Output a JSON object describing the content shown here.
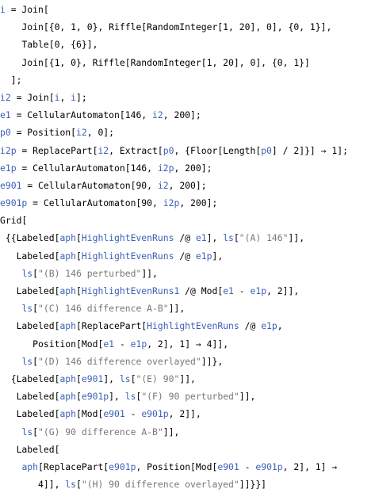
{
  "notebook": {
    "input_cell": [
      [
        [
          "u",
          "i"
        ],
        [
          "k",
          " = Join["
        ]
      ],
      [
        [
          "k",
          "    Join[{0, 1, 0}, Riffle[RandomInteger[1, 20], 0], {0, 1}],"
        ]
      ],
      [
        [
          "k",
          "    Table[0, {6}],"
        ]
      ],
      [
        [
          "k",
          "    Join[{1, 0}, Riffle[RandomInteger[1, 20], 0], {0, 1}]"
        ]
      ],
      [
        [
          "k",
          "  ];"
        ]
      ],
      [
        [
          "u",
          "i2"
        ],
        [
          "k",
          " = Join["
        ],
        [
          "u",
          "i"
        ],
        [
          "k",
          ", "
        ],
        [
          "u",
          "i"
        ],
        [
          "k",
          "];"
        ]
      ],
      [
        [
          "u",
          "e1"
        ],
        [
          "k",
          " = CellularAutomaton[146, "
        ],
        [
          "u",
          "i2"
        ],
        [
          "k",
          ", 200];"
        ]
      ],
      [
        [
          "u",
          "p0"
        ],
        [
          "k",
          " = Position["
        ],
        [
          "u",
          "i2"
        ],
        [
          "k",
          ", 0];"
        ]
      ],
      [
        [
          "u",
          "i2p"
        ],
        [
          "k",
          " = ReplacePart["
        ],
        [
          "u",
          "i2"
        ],
        [
          "k",
          ", Extract["
        ],
        [
          "u",
          "p0"
        ],
        [
          "k",
          ", {Floor[Length["
        ],
        [
          "u",
          "p0"
        ],
        [
          "k",
          "] / 2]}] → 1];"
        ]
      ],
      [
        [
          "u",
          "e1p"
        ],
        [
          "k",
          " = CellularAutomaton[146, "
        ],
        [
          "u",
          "i2p"
        ],
        [
          "k",
          ", 200];"
        ]
      ],
      [
        [
          "u",
          "e901"
        ],
        [
          "k",
          " = CellularAutomaton[90, "
        ],
        [
          "u",
          "i2"
        ],
        [
          "k",
          ", 200];"
        ]
      ],
      [
        [
          "u",
          "e901p"
        ],
        [
          "k",
          " = CellularAutomaton[90, "
        ],
        [
          "u",
          "i2p"
        ],
        [
          "k",
          ", 200];"
        ]
      ],
      [
        [
          "k",
          "Grid["
        ]
      ],
      [
        [
          "k",
          " {{Labeled["
        ],
        [
          "u",
          "aph"
        ],
        [
          "k",
          "["
        ],
        [
          "u",
          "HighlightEvenRuns"
        ],
        [
          "k",
          " /@ "
        ],
        [
          "u",
          "e1"
        ],
        [
          "k",
          "], "
        ],
        [
          "u",
          "ls"
        ],
        [
          "k",
          "["
        ],
        [
          "s",
          "\"(A) 146\""
        ],
        [
          "k",
          "]],"
        ]
      ],
      [
        [
          "k",
          "   Labeled["
        ],
        [
          "u",
          "aph"
        ],
        [
          "k",
          "["
        ],
        [
          "u",
          "HighlightEvenRuns"
        ],
        [
          "k",
          " /@ "
        ],
        [
          "u",
          "e1p"
        ],
        [
          "k",
          "],"
        ]
      ],
      [
        [
          "k",
          "    "
        ],
        [
          "u",
          "ls"
        ],
        [
          "k",
          "["
        ],
        [
          "s",
          "\"(B) 146 perturbed\""
        ],
        [
          "k",
          "]],"
        ]
      ],
      [
        [
          "k",
          "   Labeled["
        ],
        [
          "u",
          "aph"
        ],
        [
          "k",
          "["
        ],
        [
          "u",
          "HighlightEvenRuns1"
        ],
        [
          "k",
          " /@ Mod["
        ],
        [
          "u",
          "e1"
        ],
        [
          "k",
          " - "
        ],
        [
          "u",
          "e1p"
        ],
        [
          "k",
          ", 2]],"
        ]
      ],
      [
        [
          "k",
          "    "
        ],
        [
          "u",
          "ls"
        ],
        [
          "k",
          "["
        ],
        [
          "s",
          "\"(C) 146 difference A-B\""
        ],
        [
          "k",
          "]],"
        ]
      ],
      [
        [
          "k",
          "   Labeled["
        ],
        [
          "u",
          "aph"
        ],
        [
          "k",
          "[ReplacePart["
        ],
        [
          "u",
          "HighlightEvenRuns"
        ],
        [
          "k",
          " /@ "
        ],
        [
          "u",
          "e1p"
        ],
        [
          "k",
          ","
        ]
      ],
      [
        [
          "k",
          "      Position[Mod["
        ],
        [
          "u",
          "e1"
        ],
        [
          "k",
          " - "
        ],
        [
          "u",
          "e1p"
        ],
        [
          "k",
          ", 2], 1] → 4]], "
        ]
      ],
      [
        [
          "k",
          "    "
        ],
        [
          "u",
          "ls"
        ],
        [
          "k",
          "["
        ],
        [
          "s",
          "\"(D) 146 difference overlayed\""
        ],
        [
          "k",
          "]]},"
        ]
      ],
      [
        [
          "k",
          "  {Labeled["
        ],
        [
          "u",
          "aph"
        ],
        [
          "k",
          "["
        ],
        [
          "u",
          "e901"
        ],
        [
          "k",
          "], "
        ],
        [
          "u",
          "ls"
        ],
        [
          "k",
          "["
        ],
        [
          "s",
          "\"(E) 90\""
        ],
        [
          "k",
          "]],"
        ]
      ],
      [
        [
          "k",
          "   Labeled["
        ],
        [
          "u",
          "aph"
        ],
        [
          "k",
          "["
        ],
        [
          "u",
          "e901p"
        ],
        [
          "k",
          "], "
        ],
        [
          "u",
          "ls"
        ],
        [
          "k",
          "["
        ],
        [
          "s",
          "\"(F) 90 perturbed\""
        ],
        [
          "k",
          "]],"
        ]
      ],
      [
        [
          "k",
          "   Labeled["
        ],
        [
          "u",
          "aph"
        ],
        [
          "k",
          "[Mod["
        ],
        [
          "u",
          "e901"
        ],
        [
          "k",
          " - "
        ],
        [
          "u",
          "e901p"
        ],
        [
          "k",
          ", 2]],"
        ]
      ],
      [
        [
          "k",
          "    "
        ],
        [
          "u",
          "ls"
        ],
        [
          "k",
          "["
        ],
        [
          "s",
          "\"(G) 90 difference A-B\""
        ],
        [
          "k",
          "]],"
        ]
      ],
      [
        [
          "k",
          "   Labeled["
        ]
      ],
      [
        [
          "k",
          "    "
        ],
        [
          "u",
          "aph"
        ],
        [
          "k",
          "[ReplacePart["
        ],
        [
          "u",
          "e901p"
        ],
        [
          "k",
          ", Position[Mod["
        ],
        [
          "u",
          "e901"
        ],
        [
          "k",
          " - "
        ],
        [
          "u",
          "e901p"
        ],
        [
          "k",
          ", 2], 1] →"
        ]
      ],
      [
        [
          "k",
          "       4]], "
        ],
        [
          "u",
          "ls"
        ],
        [
          "k",
          "["
        ],
        [
          "s",
          "\"(H) 90 difference overlayed\""
        ],
        [
          "k",
          "]]}}]"
        ]
      ]
    ]
  },
  "colors": {
    "symbol": "#3b5fb5",
    "string": "#777777",
    "text": "#000000",
    "background": "#ffffff"
  }
}
